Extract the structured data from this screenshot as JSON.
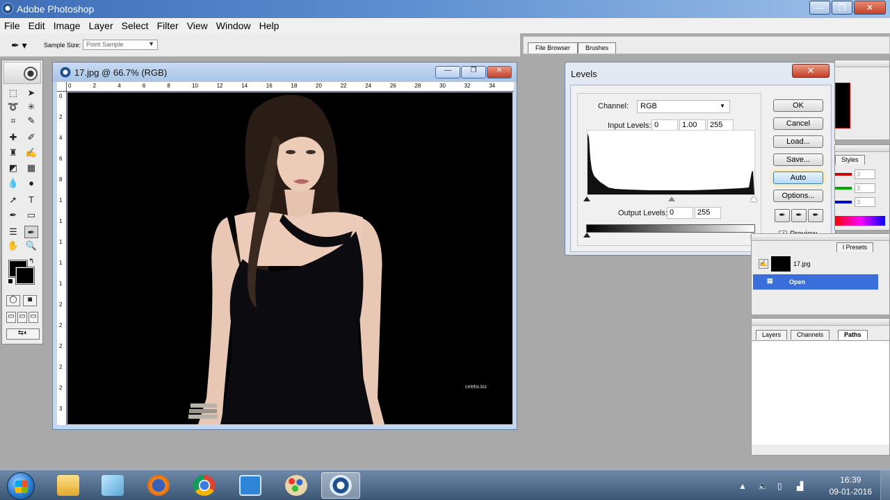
{
  "app": {
    "title": "Adobe Photoshop"
  },
  "window_buttons": {
    "minimize": "—",
    "maximize": "❐",
    "close": "✕"
  },
  "menu": [
    "File",
    "Edit",
    "Image",
    "Layer",
    "Select",
    "Filter",
    "View",
    "Window",
    "Help"
  ],
  "options_bar": {
    "sample_size_label": "Sample Size:",
    "sample_size_value": "Point Sample"
  },
  "palette_well": {
    "tabs": [
      "File Browser",
      "Brushes"
    ]
  },
  "document": {
    "title": "17.jpg @ 66.7% (RGB)",
    "ruler_h": [
      "0",
      "2",
      "4",
      "6",
      "8",
      "10",
      "12",
      "14",
      "16",
      "18",
      "20",
      "22",
      "24",
      "26",
      "28",
      "30",
      "32",
      "34"
    ],
    "ruler_v": [
      "0",
      "2",
      "4",
      "6",
      "8",
      "1",
      "1",
      "1",
      "1",
      "1",
      "2",
      "2",
      "2",
      "2",
      "2",
      "3"
    ],
    "watermark": "celebs.biz"
  },
  "levels": {
    "title": "Levels",
    "channel_label": "Channel:",
    "channel_value": "RGB",
    "input_label": "Input Levels:",
    "input_black": "0",
    "input_gamma": "1.00",
    "input_white": "255",
    "output_label": "Output Levels:",
    "output_black": "0",
    "output_white": "255",
    "buttons": {
      "ok": "OK",
      "cancel": "Cancel",
      "load": "Load...",
      "save": "Save...",
      "auto": "Auto",
      "options": "Options..."
    },
    "preview_label": "Preview",
    "preview_checked": "✓"
  },
  "palettes": {
    "color_tab": "Styles",
    "color_values": [
      "3",
      "3",
      "3"
    ],
    "history_tab": "l Presets",
    "history_items": [
      {
        "label": "17.jpg"
      },
      {
        "label": "Open"
      }
    ],
    "layers_tabs": [
      "Layers",
      "Channels",
      "Paths"
    ]
  },
  "taskbar": {
    "time": "16:39",
    "date": "09-01-2016"
  }
}
